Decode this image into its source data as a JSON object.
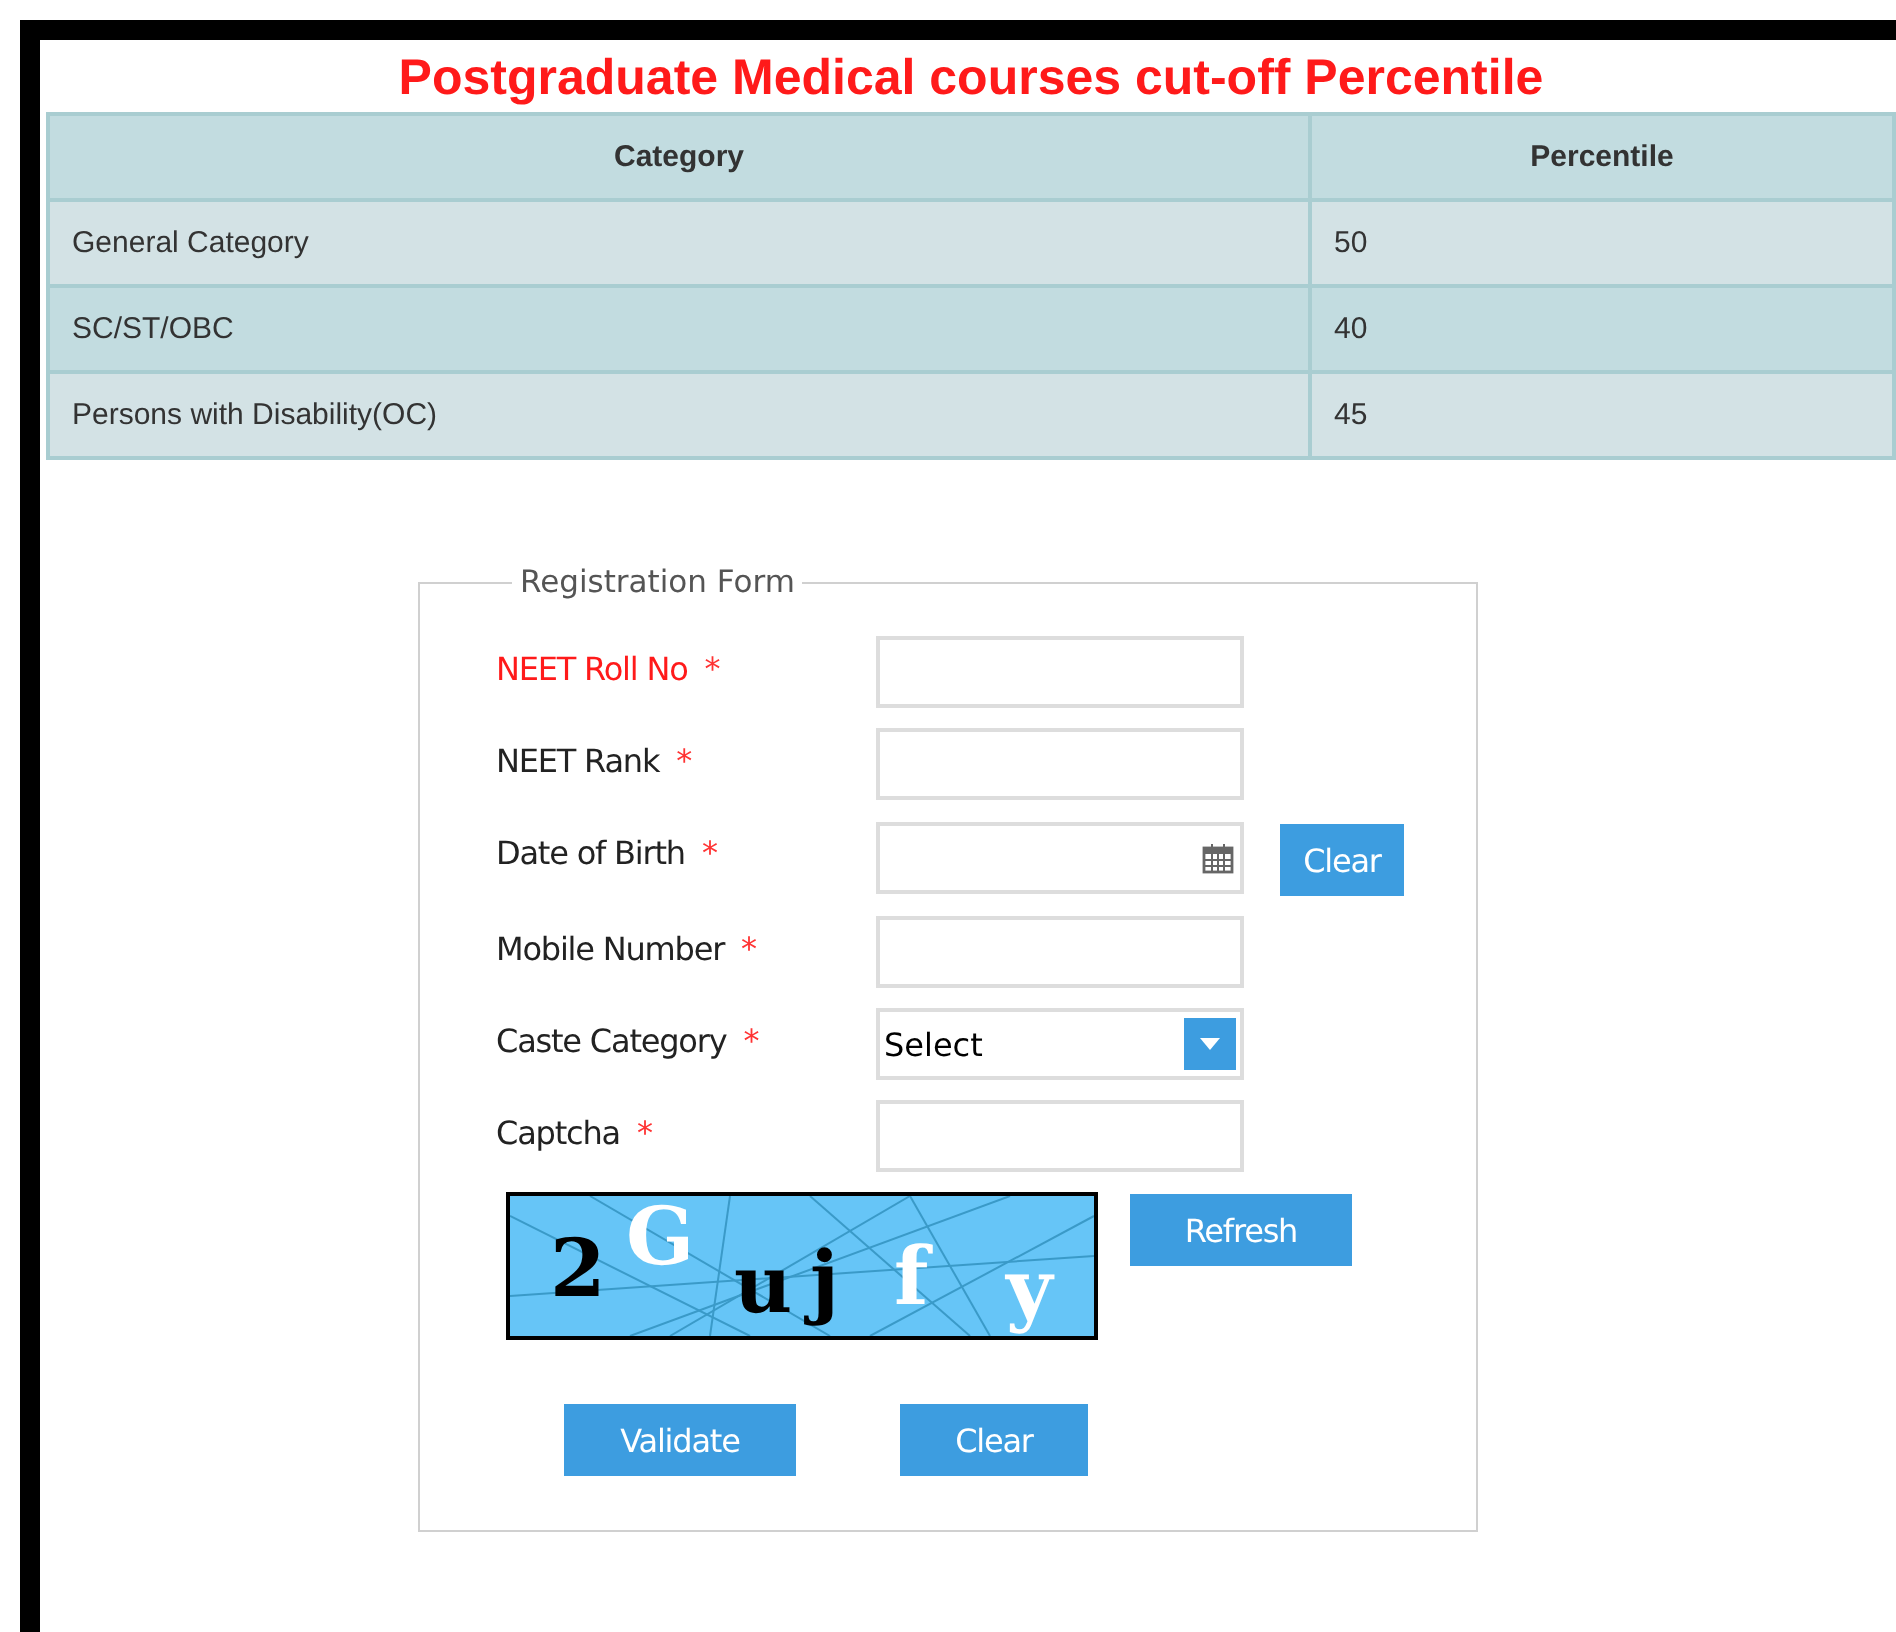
{
  "title": "Postgraduate Medical courses cut-off Percentile",
  "table": {
    "columns": [
      "Category",
      "Percentile"
    ],
    "rows": [
      [
        "General Category",
        "50"
      ],
      [
        "SC/ST/OBC",
        "40"
      ],
      [
        "Persons with Disability(OC)",
        "45"
      ]
    ]
  },
  "form": {
    "legend": "Registration Form",
    "fields": [
      {
        "kind": "text",
        "label": "NEET Roll No",
        "required_mark": "*",
        "highlighted": true
      },
      {
        "kind": "text",
        "label": "NEET Rank",
        "required_mark": "*",
        "highlighted": false
      },
      {
        "kind": "date",
        "label": "Date of Birth",
        "required_mark": "*",
        "highlighted": false,
        "button": "Clear"
      },
      {
        "kind": "text",
        "label": "Mobile Number",
        "required_mark": "*",
        "highlighted": false
      },
      {
        "kind": "select",
        "label": "Caste Category",
        "required_mark": "*",
        "highlighted": false,
        "value": "Select"
      },
      {
        "kind": "text",
        "label": "Captcha",
        "required_mark": "*",
        "highlighted": false
      }
    ],
    "captcha": {
      "characters": [
        "2",
        "G",
        "u",
        "j",
        "f",
        "y"
      ],
      "refresh_button": "Refresh"
    },
    "buttons": [
      "Validate",
      "Clear"
    ]
  }
}
